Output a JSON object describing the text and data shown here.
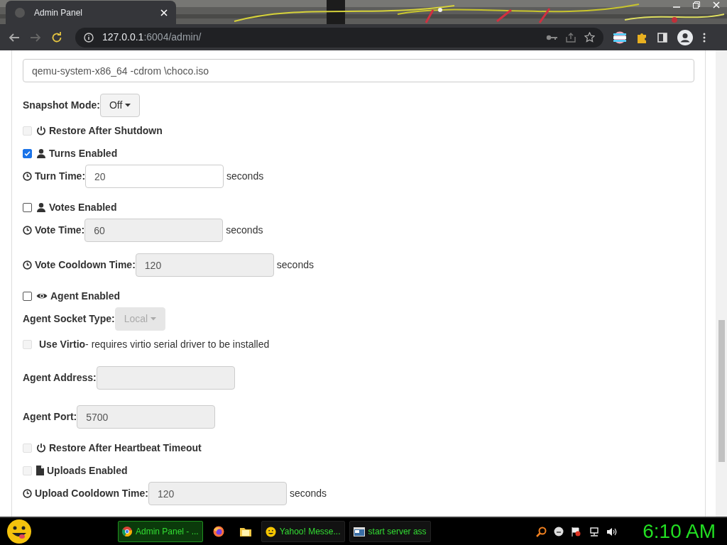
{
  "browser": {
    "tab_title": "Admin Panel",
    "url_host": "127.0.0.1",
    "url_rest": ":6004/admin/"
  },
  "form": {
    "rows": [
      {
        "kind": "command_field",
        "value": "qemu-system-x86_64 -cdrom \\choco.iso",
        "disabled": false
      },
      {
        "kind": "dropdown",
        "label": "Snapshot Mode:",
        "value": "Off",
        "disabled": false
      },
      {
        "kind": "power_toggle",
        "label": "Restore After Shutdown",
        "checked": false,
        "disabled": true
      },
      {
        "kind": "user_toggle",
        "label": "Turns Enabled",
        "checked": true,
        "disabled": false
      },
      {
        "kind": "timed_field",
        "label": "Turn Time:",
        "value": "20",
        "unit": "seconds",
        "disabled": false
      },
      {
        "kind": "user_toggle",
        "label": "Votes Enabled",
        "checked": false,
        "disabled": false
      },
      {
        "kind": "timed_field",
        "label": "Vote Time:",
        "value": "60",
        "unit": "seconds",
        "disabled": true
      },
      {
        "kind": "timed_field",
        "label": "Vote Cooldown Time:",
        "value": "120",
        "unit": "seconds",
        "disabled": true
      },
      {
        "kind": "eye_toggle",
        "label": "Agent Enabled",
        "checked": false,
        "disabled": false
      },
      {
        "kind": "dropdown",
        "label": "Agent Socket Type:",
        "value": "Local",
        "disabled": true
      },
      {
        "kind": "plain_toggle",
        "label": "Use Virtio",
        "note": "- requires virtio serial driver to be installed",
        "checked": false,
        "disabled": true
      },
      {
        "kind": "field",
        "label": "Agent Address:",
        "value": "",
        "disabled": true
      },
      {
        "kind": "field",
        "label": "Agent Port:",
        "value": "5700",
        "disabled": true
      },
      {
        "kind": "power_toggle",
        "label": "Restore After Heartbeat Timeout",
        "checked": false,
        "disabled": true
      },
      {
        "kind": "file_toggle",
        "label": "Uploads Enabled",
        "checked": false,
        "disabled": true
      },
      {
        "kind": "timed_field",
        "label": "Upload Cooldown Time:",
        "value": "120",
        "unit": "seconds",
        "disabled": true
      }
    ]
  },
  "taskbar": {
    "tasks": [
      {
        "kind": "chrome",
        "label": "Admin Panel - ...",
        "selected": true
      },
      {
        "kind": "firefox",
        "selected": false
      },
      {
        "kind": "folder",
        "selected": false
      },
      {
        "kind": "messenger",
        "label": "Yahoo! Messe...",
        "selected": false
      },
      {
        "kind": "console",
        "label": "start server ass",
        "selected": false
      }
    ],
    "clock": "6:10 AM"
  }
}
